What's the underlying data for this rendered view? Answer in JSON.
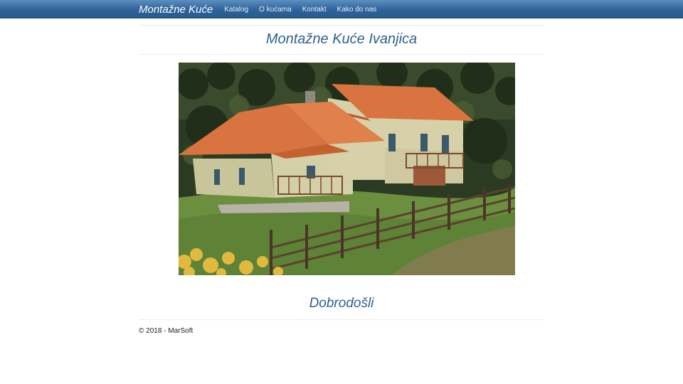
{
  "navbar": {
    "brand": "Montažne Kuće",
    "links": [
      "Katalog",
      "O kućama",
      "Kontakt",
      "Kako do nas"
    ]
  },
  "page": {
    "title": "Montažne Kuće Ivanjica",
    "welcome": "Dobrodošli"
  },
  "footer": {
    "text": "© 2018 - MarSoft"
  },
  "colors": {
    "navbar": "#2f6399",
    "heading": "#2f5f8f",
    "roof": "#d9733f"
  }
}
